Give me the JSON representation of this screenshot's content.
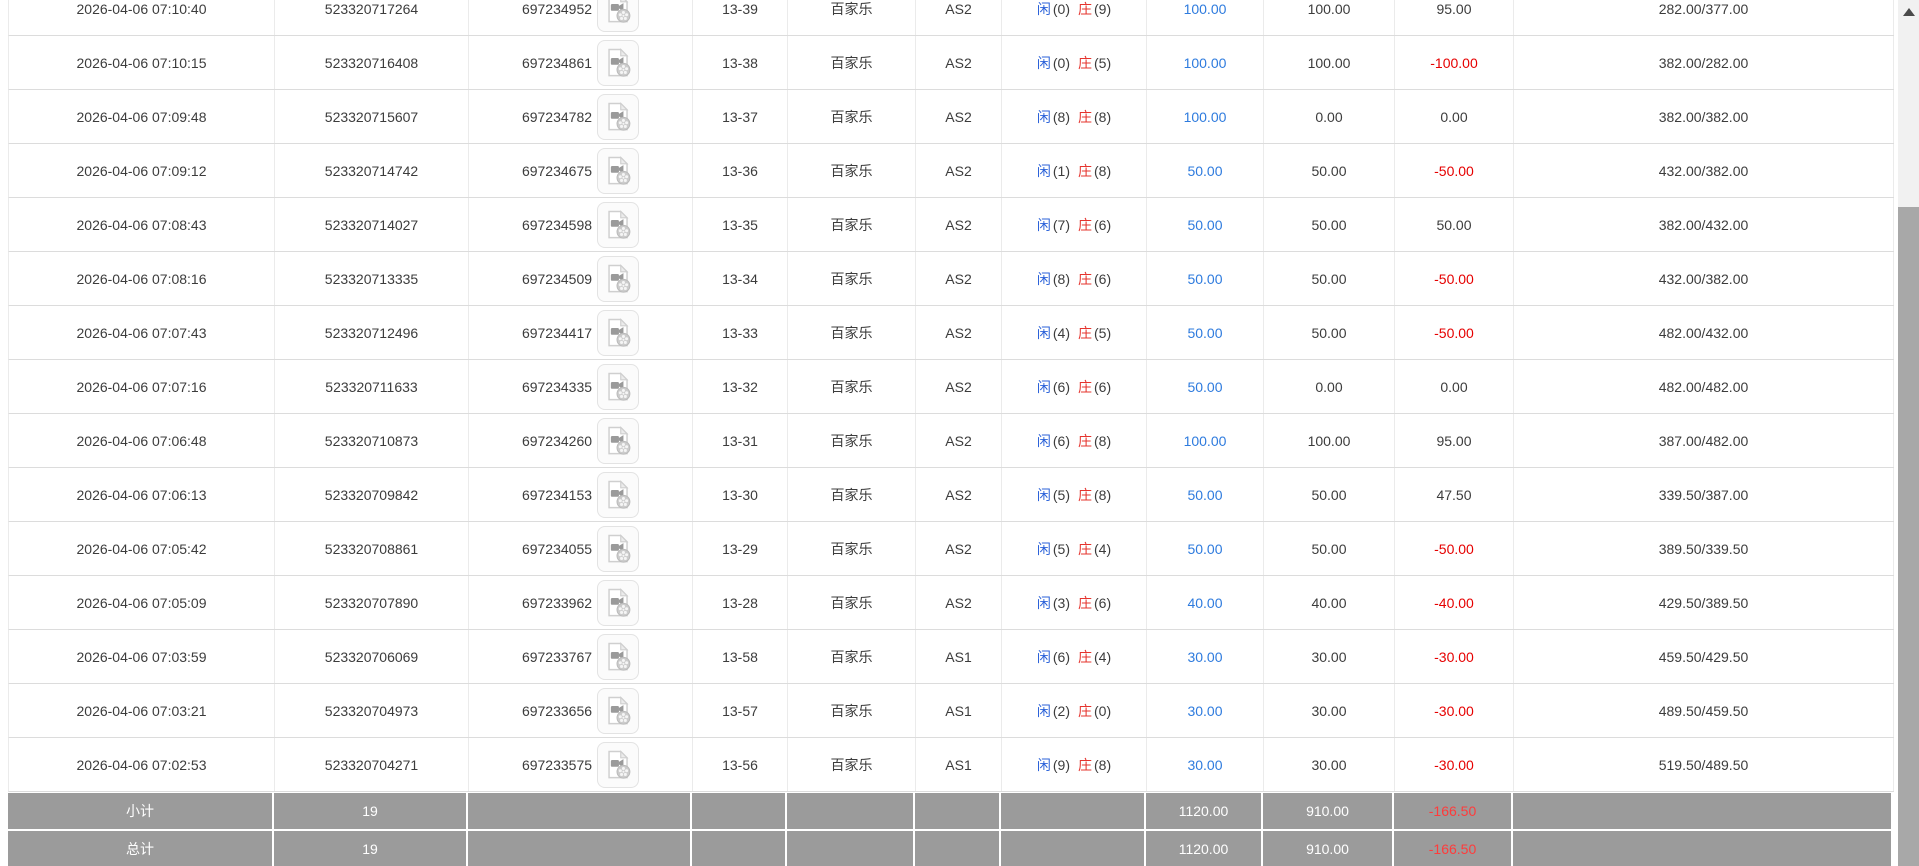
{
  "labels": {
    "player": "闲",
    "banker": "庄",
    "game_name": "百家乐"
  },
  "colors": {
    "link_blue": "#2e7bde",
    "player_blue": "#2b62d9",
    "banker_red": "#e5342e",
    "negative_red": "#e60000",
    "footer_bg": "#9b9b9b",
    "footer_negative_red": "#ff3b3b",
    "row_border": "#dcdcdc"
  },
  "table": {
    "rows": [
      {
        "time": "2026-04-06 07:10:40",
        "game_no": "523320717264",
        "bet_no": "697234952",
        "round": "13-39",
        "game": "百家乐",
        "table_code": "AS2",
        "player": "0",
        "banker": "9",
        "bet": "100.00",
        "valid": "100.00",
        "win": "95.00",
        "balance": "282.00/377.00"
      },
      {
        "time": "2026-04-06 07:10:15",
        "game_no": "523320716408",
        "bet_no": "697234861",
        "round": "13-38",
        "game": "百家乐",
        "table_code": "AS2",
        "player": "0",
        "banker": "5",
        "bet": "100.00",
        "valid": "100.00",
        "win": "-100.00",
        "balance": "382.00/282.00"
      },
      {
        "time": "2026-04-06 07:09:48",
        "game_no": "523320715607",
        "bet_no": "697234782",
        "round": "13-37",
        "game": "百家乐",
        "table_code": "AS2",
        "player": "8",
        "banker": "8",
        "bet": "100.00",
        "valid": "0.00",
        "win": "0.00",
        "balance": "382.00/382.00"
      },
      {
        "time": "2026-04-06 07:09:12",
        "game_no": "523320714742",
        "bet_no": "697234675",
        "round": "13-36",
        "game": "百家乐",
        "table_code": "AS2",
        "player": "1",
        "banker": "8",
        "bet": "50.00",
        "valid": "50.00",
        "win": "-50.00",
        "balance": "432.00/382.00"
      },
      {
        "time": "2026-04-06 07:08:43",
        "game_no": "523320714027",
        "bet_no": "697234598",
        "round": "13-35",
        "game": "百家乐",
        "table_code": "AS2",
        "player": "7",
        "banker": "6",
        "bet": "50.00",
        "valid": "50.00",
        "win": "50.00",
        "balance": "382.00/432.00"
      },
      {
        "time": "2026-04-06 07:08:16",
        "game_no": "523320713335",
        "bet_no": "697234509",
        "round": "13-34",
        "game": "百家乐",
        "table_code": "AS2",
        "player": "8",
        "banker": "6",
        "bet": "50.00",
        "valid": "50.00",
        "win": "-50.00",
        "balance": "432.00/382.00"
      },
      {
        "time": "2026-04-06 07:07:43",
        "game_no": "523320712496",
        "bet_no": "697234417",
        "round": "13-33",
        "game": "百家乐",
        "table_code": "AS2",
        "player": "4",
        "banker": "5",
        "bet": "50.00",
        "valid": "50.00",
        "win": "-50.00",
        "balance": "482.00/432.00"
      },
      {
        "time": "2026-04-06 07:07:16",
        "game_no": "523320711633",
        "bet_no": "697234335",
        "round": "13-32",
        "game": "百家乐",
        "table_code": "AS2",
        "player": "6",
        "banker": "6",
        "bet": "50.00",
        "valid": "0.00",
        "win": "0.00",
        "balance": "482.00/482.00"
      },
      {
        "time": "2026-04-06 07:06:48",
        "game_no": "523320710873",
        "bet_no": "697234260",
        "round": "13-31",
        "game": "百家乐",
        "table_code": "AS2",
        "player": "6",
        "banker": "8",
        "bet": "100.00",
        "valid": "100.00",
        "win": "95.00",
        "balance": "387.00/482.00"
      },
      {
        "time": "2026-04-06 07:06:13",
        "game_no": "523320709842",
        "bet_no": "697234153",
        "round": "13-30",
        "game": "百家乐",
        "table_code": "AS2",
        "player": "5",
        "banker": "8",
        "bet": "50.00",
        "valid": "50.00",
        "win": "47.50",
        "balance": "339.50/387.00"
      },
      {
        "time": "2026-04-06 07:05:42",
        "game_no": "523320708861",
        "bet_no": "697234055",
        "round": "13-29",
        "game": "百家乐",
        "table_code": "AS2",
        "player": "5",
        "banker": "4",
        "bet": "50.00",
        "valid": "50.00",
        "win": "-50.00",
        "balance": "389.50/339.50"
      },
      {
        "time": "2026-04-06 07:05:09",
        "game_no": "523320707890",
        "bet_no": "697233962",
        "round": "13-28",
        "game": "百家乐",
        "table_code": "AS2",
        "player": "3",
        "banker": "6",
        "bet": "40.00",
        "valid": "40.00",
        "win": "-40.00",
        "balance": "429.50/389.50"
      },
      {
        "time": "2026-04-06 07:03:59",
        "game_no": "523320706069",
        "bet_no": "697233767",
        "round": "13-58",
        "game": "百家乐",
        "table_code": "AS1",
        "player": "6",
        "banker": "4",
        "bet": "30.00",
        "valid": "30.00",
        "win": "-30.00",
        "balance": "459.50/429.50"
      },
      {
        "time": "2026-04-06 07:03:21",
        "game_no": "523320704973",
        "bet_no": "697233656",
        "round": "13-57",
        "game": "百家乐",
        "table_code": "AS1",
        "player": "2",
        "banker": "0",
        "bet": "30.00",
        "valid": "30.00",
        "win": "-30.00",
        "balance": "489.50/459.50"
      },
      {
        "time": "2026-04-06 07:02:53",
        "game_no": "523320704271",
        "bet_no": "697233575",
        "round": "13-56",
        "game": "百家乐",
        "table_code": "AS1",
        "player": "9",
        "banker": "8",
        "bet": "30.00",
        "valid": "30.00",
        "win": "-30.00",
        "balance": "519.50/489.50"
      }
    ],
    "footer": [
      {
        "label": "小计",
        "count": "19",
        "bet": "1120.00",
        "valid": "910.00",
        "win": "-166.50"
      },
      {
        "label": "总计",
        "count": "19",
        "bet": "1120.00",
        "valid": "910.00",
        "win": "-166.50"
      }
    ]
  }
}
